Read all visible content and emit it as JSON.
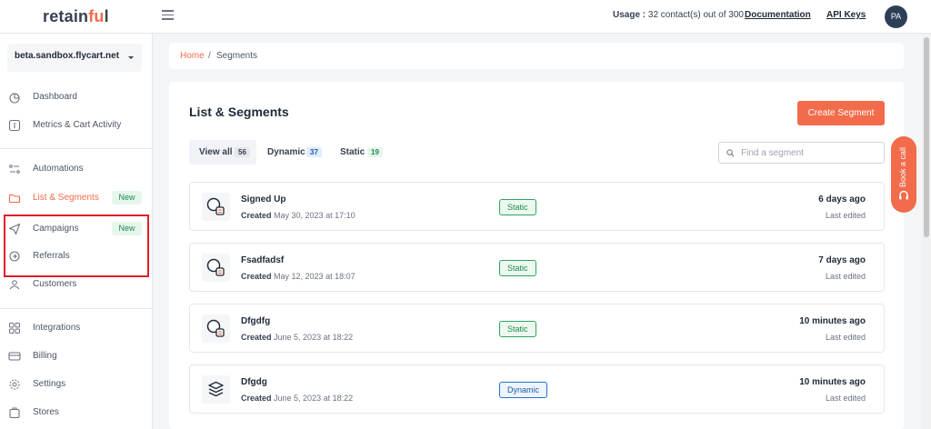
{
  "header": {
    "logo_main": "retain",
    "logo_accent": "fu",
    "logo_end": "l",
    "usage_label": "Usage :",
    "usage_value": "32 contact(s) out of 300",
    "documentation": "Documentation",
    "api_keys": "API Keys",
    "avatar": "PA"
  },
  "sidebar": {
    "store": "beta.sandbox.flycart.net",
    "items": [
      {
        "label": "Dashboard",
        "icon": "dashboard-icon"
      },
      {
        "label": "Metrics & Cart Activity",
        "icon": "metrics-icon"
      },
      {
        "label": "Automations",
        "icon": "automations-icon"
      },
      {
        "label": "List & Segments",
        "icon": "folder-icon",
        "badge": "New",
        "active": true
      },
      {
        "label": "Campaigns",
        "icon": "send-icon",
        "badge": "New"
      },
      {
        "label": "Referrals",
        "icon": "referrals-icon"
      },
      {
        "label": "Customers",
        "icon": "customers-icon"
      },
      {
        "label": "Integrations",
        "icon": "integrations-icon"
      },
      {
        "label": "Billing",
        "icon": "billing-icon"
      },
      {
        "label": "Settings",
        "icon": "settings-icon"
      },
      {
        "label": "Stores",
        "icon": "stores-icon"
      }
    ]
  },
  "breadcrumb": {
    "home": "Home",
    "separator": "/",
    "current": "Segments"
  },
  "main": {
    "title": "List & Segments",
    "create_button": "Create Segment",
    "tabs": [
      {
        "label": "View all",
        "count": "56"
      },
      {
        "label": "Dynamic",
        "count": "37"
      },
      {
        "label": "Static",
        "count": "19"
      }
    ],
    "search_placeholder": "Find a segment",
    "created_label": "Created",
    "rows": [
      {
        "name": "Signed Up",
        "created": "May 30, 2023 at 17:10",
        "type": "Static",
        "time": "6 days ago",
        "sub": "Last edited",
        "icon": "static-segment-icon"
      },
      {
        "name": "Fsadfadsf",
        "created": "May 12, 2023 at 18:07",
        "type": "Static",
        "time": "7 days ago",
        "sub": "Last edited",
        "icon": "static-segment-icon"
      },
      {
        "name": "Dfgdfg",
        "created": "June 5, 2023 at 18:22",
        "type": "Static",
        "time": "10 minutes ago",
        "sub": "Last edited",
        "icon": "static-segment-icon"
      },
      {
        "name": "Dfgdg",
        "created": "June 5, 2023 at 18:22",
        "type": "Dynamic",
        "time": "10 minutes ago",
        "sub": "Last edited",
        "icon": "dynamic-segment-icon"
      }
    ]
  },
  "book_call": "Book a call",
  "colors": {
    "accent": "#f26b4a",
    "highlight": "#e11d2a",
    "static_green": "#1f8a4c",
    "dynamic_blue": "#1e5aa8"
  }
}
